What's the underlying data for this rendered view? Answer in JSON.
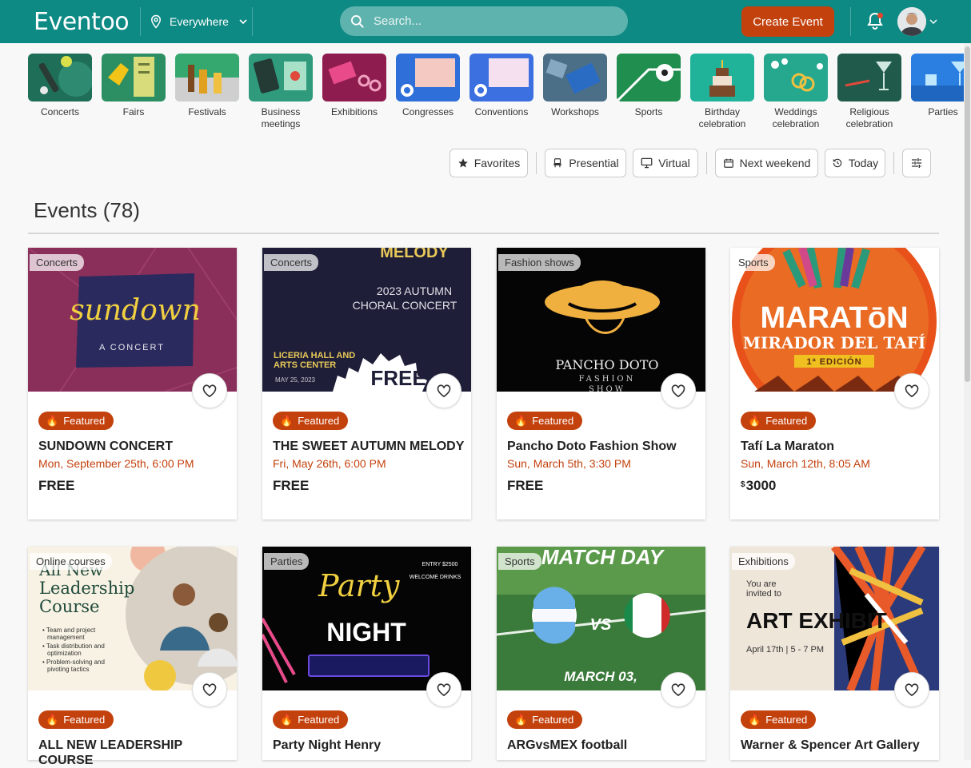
{
  "app": {
    "logo": "Eventoo"
  },
  "header": {
    "location": "Everywhere",
    "search_placeholder": "Search...",
    "create_label": "Create Event"
  },
  "categories": [
    {
      "label": "Concerts",
      "icon": "concert-icon"
    },
    {
      "label": "Fairs",
      "icon": "fair-icon"
    },
    {
      "label": "Festivals",
      "icon": "festival-icon"
    },
    {
      "label": "Business meetings",
      "icon": "business-icon"
    },
    {
      "label": "Exhibitions",
      "icon": "exhibition-icon"
    },
    {
      "label": "Congresses",
      "icon": "congress-icon"
    },
    {
      "label": "Conventions",
      "icon": "convention-icon"
    },
    {
      "label": "Workshops",
      "icon": "workshop-icon"
    },
    {
      "label": "Sports",
      "icon": "sports-icon"
    },
    {
      "label": "Birthday celebration",
      "icon": "birthday-icon"
    },
    {
      "label": "Weddings celebration",
      "icon": "wedding-icon"
    },
    {
      "label": "Religious celebration",
      "icon": "religious-icon"
    },
    {
      "label": "Parties",
      "icon": "parties-icon"
    }
  ],
  "filters": {
    "favorites": "Favorites",
    "presential": "Presential",
    "virtual": "Virtual",
    "next_weekend": "Next weekend",
    "today": "Today"
  },
  "events_heading": "Events (78)",
  "colors": {
    "brand": "#0e8a84",
    "accent": "#c3410d"
  },
  "events": [
    {
      "category": "Concerts",
      "badge": "Featured",
      "title": "SUNDOWN CONCERT",
      "date": "Mon, September 25th, 6:00 PM",
      "price": "FREE",
      "currency": "",
      "art": {
        "script": "sundown",
        "sub": "A CONCERT"
      }
    },
    {
      "category": "Concerts",
      "badge": "Featured",
      "title": "THE SWEET AUTUMN MELODY",
      "date": "Fri, May 26th, 6:00 PM",
      "price": "FREE",
      "currency": "",
      "art": {
        "top": "MELODY",
        "l1": "2023 AUTUMN",
        "l2": "CHORAL CONCERT",
        "venue1": "LICERIA HALL AND",
        "venue2": "ARTS CENTER",
        "small": "MAY 25, 2023",
        "free": "FREE"
      }
    },
    {
      "category": "Fashion shows",
      "badge": "Featured",
      "title": "Pancho Doto Fashion Show",
      "date": "Sun, March 5th, 3:30 PM",
      "price": "FREE",
      "currency": "",
      "art": {
        "name": "PANCHO DOTO",
        "sub": "FASHION",
        "sub2": "SHOW"
      }
    },
    {
      "category": "Sports",
      "badge": "Featured",
      "title": "Tafí La Maraton",
      "date": "Sun, March 12th, 8:05 AM",
      "price": "3000",
      "currency": "$",
      "art": {
        "l1": "MARATōN",
        "l2": "MIRADOR DEL TAFÍ",
        "ed": "1ª EDICIÓN"
      }
    },
    {
      "category": "Online courses",
      "badge": "Featured",
      "title": "ALL NEW LEADERSHIP COURSE",
      "date": "",
      "price": "",
      "currency": "",
      "art": {
        "l0": "All New",
        "l1": "Leadership",
        "l2": "Course",
        "b1": "• Team and project",
        "b1b": "management",
        "b2": "• Task distribution and",
        "b2b": "optimization",
        "b3": "• Problem-solving and",
        "b3b": "pivoting tactics"
      }
    },
    {
      "category": "Parties",
      "badge": "Featured",
      "title": "Party Night Henry",
      "date": "",
      "price": "",
      "currency": "",
      "art": {
        "script": "Party",
        "night": "NIGHT",
        "entry": "ENTRY $2500",
        "drinks": "WELCOME DRINKS"
      }
    },
    {
      "category": "Sports",
      "badge": "Featured",
      "title": "ARGvsMEX football",
      "date": "",
      "price": "",
      "currency": "",
      "art": {
        "top": "MATCH DAY",
        "vs": "VS",
        "bottom": "MARCH 03,"
      }
    },
    {
      "category": "Exhibitions",
      "badge": "Featured",
      "title": "Warner & Spencer Art Gallery",
      "date": "",
      "price": "",
      "currency": "",
      "art": {
        "l1": "You are",
        "l2": "invited to",
        "big": "ART EXHIBIT",
        "when": "April 17th | 5 - 7 PM"
      }
    }
  ]
}
